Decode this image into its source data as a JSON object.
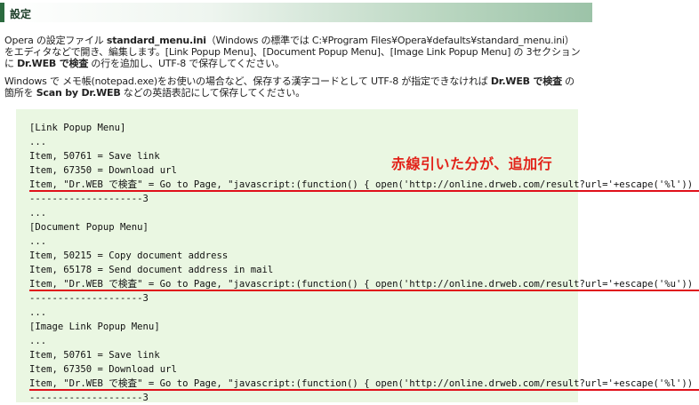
{
  "header": {
    "title": "設定"
  },
  "intro": {
    "p1_a": "Opera の設定ファイル ",
    "p1_file": "standard_menu.ini",
    "p1_b": "（Windows の標準では C:¥Program Files¥Opera¥defaults¥standard_menu.ini）をエディタなどで開き、編集します。[Link Popup Menu]、[Document Popup Menu]、[Image Link Popup Menu] の 3セクションに ",
    "p1_bold": "Dr.WEB で検査",
    "p1_c": " の行を追加し、UTF-8 で保存してください。",
    "p2_a": "Windows で メモ帳(notepad.exe)をお使いの場合など、保存する漢字コードとして UTF-8 が指定できなければ ",
    "p2_bold1": "Dr.WEB で検査",
    "p2_b": " の箇所を ",
    "p2_bold2": "Scan by Dr.WEB",
    "p2_c": " などの英語表記にして保存してください。"
  },
  "annotation": "赤線引いた分が、追加行",
  "code": {
    "l1": "[Link Popup Menu]",
    "l2": "...",
    "l3": "Item, 50761 = Save link",
    "l4": "Item, 67350 = Download url",
    "l5": "Item, \"Dr.WEB で検査\" = Go to Page, \"javascript:(function() { open('http://online.drweb.com/result?url='+escape('%l')) } ())\"",
    "l6": "--------------------3",
    "l7": "...",
    "l8": "[Document Popup Menu]",
    "l9": "...",
    "l10": "Item, 50215 = Copy document address",
    "l11": "Item, 65178 = Send document address in mail",
    "l12": "Item, \"Dr.WEB で検査\" = Go to Page, \"javascript:(function() { open('http://online.drweb.com/result?url='+escape('%u')) } ())\"",
    "l13": "--------------------3",
    "l14": "...",
    "l15": "[Image Link Popup Menu]",
    "l16": "...",
    "l17": "Item, 50761 = Save link",
    "l18": "Item, 67350 = Download url",
    "l19": "Item, \"Dr.WEB で検査\" = Go to Page, \"javascript:(function() { open('http://online.drweb.com/result?url='+escape('%l')) } ())\"",
    "l20": "--------------------3"
  },
  "colors": {
    "accent": "#2c6b3f",
    "codebg": "#eaf7e2",
    "highlight": "#e0101a"
  }
}
